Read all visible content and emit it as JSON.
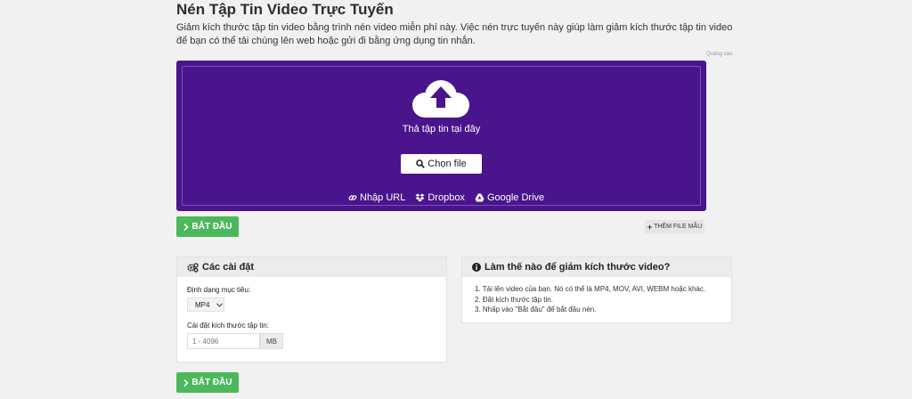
{
  "header": {
    "title": "Nén Tập Tin Video Trực Tuyến",
    "description": "Giảm kích thước tập tin video bằng trình nén video miễn phí này. Việc nén trực tuyến này giúp làm giảm kích thước tập tin video để bạn có thể tải chúng lên web hoặc gửi đi bằng ứng dụng tin nhắn.",
    "ad_label": "Quảng cáo"
  },
  "dropzone": {
    "drop_text": "Thả tập tin tại đây",
    "choose_label": "Chọn file",
    "sources": [
      {
        "label": "Nhập URL",
        "icon": "link-icon"
      },
      {
        "label": "Dropbox",
        "icon": "dropbox-icon"
      },
      {
        "label": "Google Drive",
        "icon": "google-drive-icon"
      }
    ]
  },
  "actions": {
    "start_label": "BẮT ĐẦU",
    "sample_label": "THÊM FILE MẪU"
  },
  "settings": {
    "heading": "Các cài đặt",
    "target_format_label": "Định dạng mục tiêu:",
    "target_format_value": "MP4",
    "size_label": "Cài đặt kích thước tập tin:",
    "size_placeholder": "1 - 4096",
    "size_unit": "MB"
  },
  "howto": {
    "heading": "Làm thế nào để giảm kích thước video?",
    "steps": [
      "1. Tải lên video của bạn. Nó có thể là MP4, MOV, AVI, WEBM hoặc khác.",
      "2. Đặt kích thước tập tin.",
      "3. Nhấp vào \"Bắt đầu\" để bắt đầu nén."
    ]
  },
  "colors": {
    "dropzone_bg": "#4a148c",
    "start_button": "#4cb85c"
  }
}
